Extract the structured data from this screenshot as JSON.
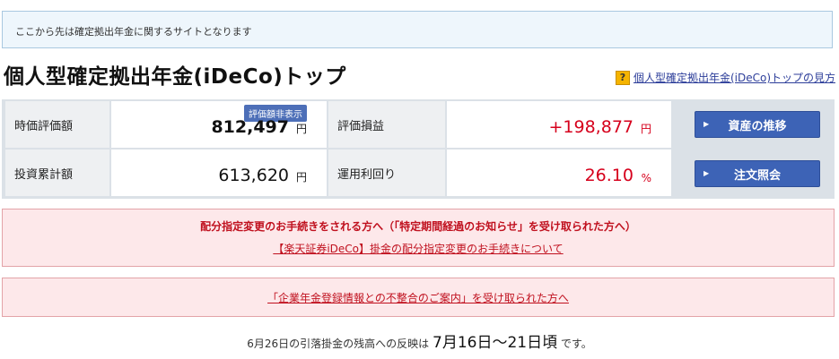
{
  "notice": {
    "text": "ここから先は確定拠出年金に関するサイトとなります"
  },
  "header": {
    "title": "個人型確定拠出年金(iDeCo)トップ",
    "help_icon": "?",
    "help_link": "個人型確定拠出年金(iDeCo)トップの見方"
  },
  "summary": {
    "market_value": {
      "label": "時価評価額",
      "badge": "評価額非表示",
      "value": "812,497",
      "unit": "円"
    },
    "cumulative": {
      "label": "投資累計額",
      "value": "613,620",
      "unit": "円"
    },
    "gain_loss": {
      "label": "評価損益",
      "value": "+198,877",
      "unit": "円"
    },
    "yield": {
      "label": "運用利回り",
      "value": "26.10",
      "unit": "%"
    },
    "buttons": {
      "asset_trend": "資産の推移",
      "order_inquiry": "注文照会",
      "arrow": "▶"
    }
  },
  "alerts": {
    "allocation_title": "配分指定変更のお手続きをされる方へ（「特定期間経過のお知らせ」を受け取られた方へ）",
    "allocation_link": "【楽天証券iDeCo】掛金の配分指定変更のお手続きについて",
    "mismatch_link": "「企業年金登録情報との不整合のご案内」を受け取られた方へ"
  },
  "footnote": {
    "prefix": "6月26日の引落掛金の残高への反映は",
    "dates": "7月16日〜21日頃",
    "suffix": "です。"
  },
  "colors": {
    "accent_blue": "#3d63b6",
    "alert_red": "#d6001c",
    "alert_bg": "#fde8ea"
  }
}
